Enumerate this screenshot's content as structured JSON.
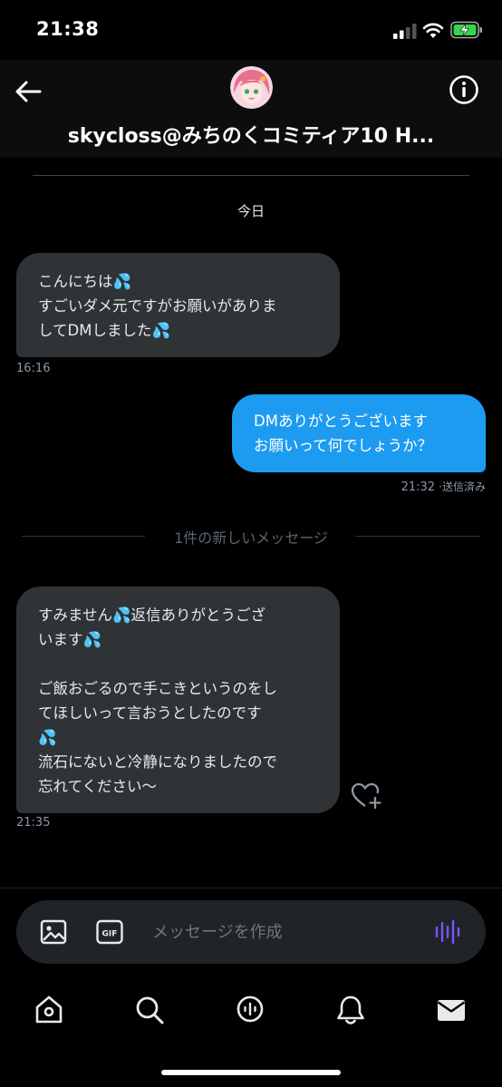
{
  "status_bar": {
    "time": "21:38"
  },
  "header": {
    "title": "skycloss@みちのくコミティア10 H...",
    "back_icon": "arrow-left-icon",
    "info_icon": "info-icon"
  },
  "conversation": {
    "date_label": "今日",
    "messages": [
      {
        "direction": "incoming",
        "lines": [
          "こんにちは💦",
          "すごいダメ元ですがお願いがありま",
          "してDMしました💦"
        ],
        "time": "16:16"
      },
      {
        "direction": "outgoing",
        "lines": [
          "DMありがとうございます",
          "お願いって何でしょうか？"
        ],
        "time": "21:32",
        "status": "·送信済み"
      },
      {
        "direction": "incoming",
        "lines": [
          "すみません💦返信ありがとうござ",
          "います💦",
          "",
          "ご飯おごるので手こきというのをし",
          "てほしいって言おうとしたのです",
          "💦",
          "流石にないと冷静になりましたので",
          "忘れてください〜"
        ],
        "time": "21:35"
      }
    ],
    "new_messages_label": "1件の新しいメッセージ"
  },
  "composer": {
    "placeholder": "メッセージを作成",
    "image_icon": "image-icon",
    "gif_icon": "gif-icon",
    "voice_icon": "voice-waveform-icon"
  },
  "tabs": [
    {
      "icon": "home-icon"
    },
    {
      "icon": "search-icon"
    },
    {
      "icon": "spaces-icon"
    },
    {
      "icon": "bell-icon"
    },
    {
      "icon": "mail-icon"
    }
  ],
  "colors": {
    "background": "#000000",
    "incoming_bubble": "#2f3336",
    "outgoing_bubble": "#1d9bf0",
    "voice_accent": "#7856ff",
    "droplet": "#4fb3f6"
  }
}
